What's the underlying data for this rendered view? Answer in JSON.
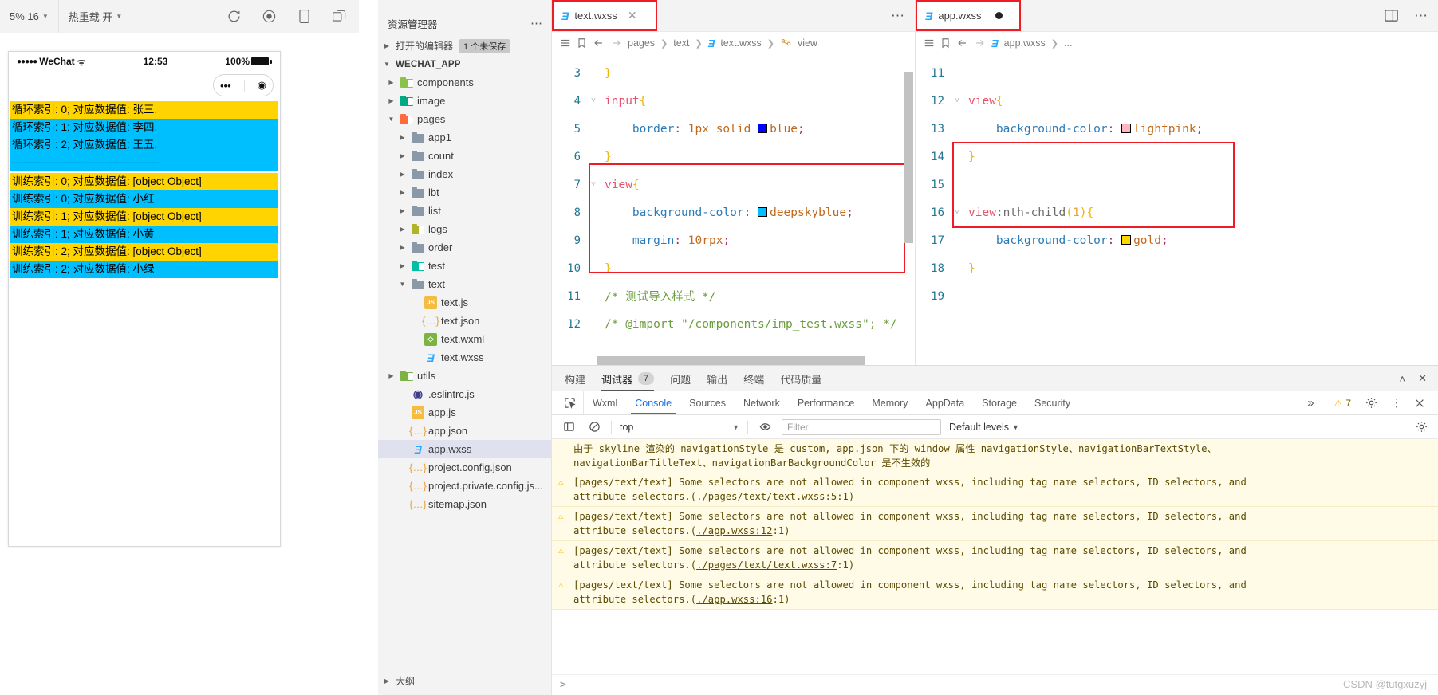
{
  "simulator": {
    "toolbar": {
      "zoom_label": "5% 16",
      "hotreload_label": "热重载 开",
      "icons": [
        "refresh-icon",
        "record-icon",
        "device-icon",
        "rotate-icon"
      ]
    },
    "phone": {
      "carrier": "WeChat",
      "time": "12:53",
      "battery": "100%",
      "capsule": {
        "more": "•••",
        "target": "◉"
      }
    },
    "rows": [
      {
        "text": "循环索引: 0; 对应数据值: 张三.",
        "bg": "gold"
      },
      {
        "text": "循环索引: 1; 对应数据值: 李四.",
        "bg": "sky"
      },
      {
        "text": "循环索引: 2; 对应数据值: 王五.",
        "bg": "sky"
      },
      {
        "text": "-----------------------------------------",
        "bg": "sky"
      },
      {
        "text": "训练索引: 0; 对应数据值: [object Object]",
        "bg": "gold"
      },
      {
        "text": "训练索引: 0; 对应数据值: 小红",
        "bg": "sky"
      },
      {
        "text": "训练索引: 1; 对应数据值: [object Object]",
        "bg": "gold"
      },
      {
        "text": "训练索引: 1; 对应数据值: 小黄",
        "bg": "sky"
      },
      {
        "text": "训练索引: 2; 对应数据值: [object Object]",
        "bg": "gold"
      },
      {
        "text": "训练索引: 2; 对应数据值: 小绿",
        "bg": "sky"
      }
    ]
  },
  "explorer": {
    "title": "资源管理器",
    "open_editors": {
      "label": "打开的编辑器",
      "badge": "1 个未保存"
    },
    "project": "WECHAT_APP",
    "tree": [
      {
        "label": "components",
        "type": "folder",
        "color": "#8bc34a",
        "indent": 1,
        "arrow": "▸"
      },
      {
        "label": "image",
        "type": "folder",
        "color": "#00a884",
        "indent": 1,
        "arrow": "▸"
      },
      {
        "label": "pages",
        "type": "folder",
        "color": "#ff6a3d",
        "indent": 1,
        "arrow": "▾"
      },
      {
        "label": "app1",
        "type": "folder",
        "color": "#8a99a8",
        "indent": 2,
        "arrow": "▸"
      },
      {
        "label": "count",
        "type": "folder",
        "color": "#8a99a8",
        "indent": 2,
        "arrow": "▸"
      },
      {
        "label": "index",
        "type": "folder",
        "color": "#8a99a8",
        "indent": 2,
        "arrow": "▸"
      },
      {
        "label": "lbt",
        "type": "folder",
        "color": "#8a99a8",
        "indent": 2,
        "arrow": "▸"
      },
      {
        "label": "list",
        "type": "folder",
        "color": "#8a99a8",
        "indent": 2,
        "arrow": "▸"
      },
      {
        "label": "logs",
        "type": "folder",
        "color": "#afb42b",
        "indent": 2,
        "arrow": "▸"
      },
      {
        "label": "order",
        "type": "folder",
        "color": "#8a99a8",
        "indent": 2,
        "arrow": "▸"
      },
      {
        "label": "test",
        "type": "folder",
        "color": "#00bfa5",
        "indent": 2,
        "arrow": "▸"
      },
      {
        "label": "text",
        "type": "folder",
        "color": "#8a99a8",
        "indent": 2,
        "arrow": "▾"
      },
      {
        "label": "text.js",
        "type": "js",
        "indent": 3,
        "arrow": ""
      },
      {
        "label": "text.json",
        "type": "json",
        "indent": 3,
        "arrow": ""
      },
      {
        "label": "text.wxml",
        "type": "wxml",
        "indent": 3,
        "arrow": ""
      },
      {
        "label": "text.wxss",
        "type": "wxss",
        "indent": 3,
        "arrow": ""
      },
      {
        "label": "utils",
        "type": "folder",
        "color": "#7cb342",
        "indent": 1,
        "arrow": "▸"
      },
      {
        "label": ".eslintrc.js",
        "type": "eslint",
        "indent": 2,
        "arrow": ""
      },
      {
        "label": "app.js",
        "type": "js",
        "indent": 2,
        "arrow": ""
      },
      {
        "label": "app.json",
        "type": "json",
        "indent": 2,
        "arrow": ""
      },
      {
        "label": "app.wxss",
        "type": "wxss",
        "indent": 2,
        "arrow": "",
        "selected": true
      },
      {
        "label": "project.config.json",
        "type": "json",
        "indent": 2,
        "arrow": ""
      },
      {
        "label": "project.private.config.js...",
        "type": "json",
        "indent": 2,
        "arrow": ""
      },
      {
        "label": "sitemap.json",
        "type": "json",
        "indent": 2,
        "arrow": ""
      }
    ],
    "bottom_section": "大纲"
  },
  "editor_left": {
    "tab": {
      "label": "text.wxss",
      "icon": "wxss-icon",
      "close": "✕"
    },
    "breadcrumb": [
      "pages",
      "text",
      "text.wxss",
      "view"
    ],
    "lines": [
      {
        "n": "3",
        "fold": "",
        "segs": [
          {
            "t": "}",
            "c": "k-brace"
          }
        ]
      },
      {
        "n": "4",
        "fold": "˅",
        "segs": [
          {
            "t": "input",
            "c": "k-sel"
          },
          {
            "t": "{",
            "c": "k-brace"
          }
        ]
      },
      {
        "n": "5",
        "fold": "",
        "segs": [
          {
            "t": "    border",
            "c": "k-prop"
          },
          {
            "t": ":",
            "c": "k-colon"
          },
          {
            "t": " 1px solid ",
            "c": "k-val"
          },
          {
            "t": "@swatch:#0000ff",
            "c": "sw"
          },
          {
            "t": "blue",
            "c": "k-val"
          },
          {
            "t": ";",
            "c": "k-semi"
          }
        ]
      },
      {
        "n": "6",
        "fold": "",
        "segs": [
          {
            "t": "}",
            "c": "k-brace"
          }
        ]
      },
      {
        "n": "7",
        "fold": "˅",
        "segs": [
          {
            "t": "view",
            "c": "k-sel"
          },
          {
            "t": "{",
            "c": "k-brace"
          }
        ]
      },
      {
        "n": "8",
        "fold": "",
        "segs": [
          {
            "t": "    background-color",
            "c": "k-prop"
          },
          {
            "t": ":",
            "c": "k-colon"
          },
          {
            "t": " ",
            "c": "k-val"
          },
          {
            "t": "@swatch:#00bfff",
            "c": "sw"
          },
          {
            "t": "deepskyblue",
            "c": "k-val"
          },
          {
            "t": ";",
            "c": "k-semi"
          }
        ]
      },
      {
        "n": "9",
        "fold": "",
        "segs": [
          {
            "t": "    margin",
            "c": "k-prop"
          },
          {
            "t": ":",
            "c": "k-colon"
          },
          {
            "t": " 10rpx",
            "c": "k-num"
          },
          {
            "t": ";",
            "c": "k-semi"
          }
        ]
      },
      {
        "n": "10",
        "fold": "",
        "segs": [
          {
            "t": "}",
            "c": "k-brace"
          }
        ]
      },
      {
        "n": "11",
        "fold": "",
        "segs": [
          {
            "t": "/* 测试导入样式 */",
            "c": "k-cmt"
          }
        ]
      },
      {
        "n": "12",
        "fold": "",
        "segs": [
          {
            "t": "/* @import \"/components/imp_test.wxss\"; */",
            "c": "k-cmt"
          }
        ]
      }
    ]
  },
  "editor_right": {
    "tab": {
      "label": "app.wxss",
      "icon": "wxss-icon",
      "dirty": true
    },
    "breadcrumb": [
      "app.wxss",
      "..."
    ],
    "lines": [
      {
        "n": "11",
        "fold": "",
        "segs": []
      },
      {
        "n": "12",
        "fold": "˅",
        "segs": [
          {
            "t": "view",
            "c": "k-sel"
          },
          {
            "t": "{",
            "c": "k-brace"
          }
        ]
      },
      {
        "n": "13",
        "fold": "",
        "segs": [
          {
            "t": "    background-color",
            "c": "k-prop"
          },
          {
            "t": ":",
            "c": "k-colon"
          },
          {
            "t": " ",
            "c": "k-val"
          },
          {
            "t": "@swatch:#ffb6c1",
            "c": "sw"
          },
          {
            "t": "lightpink",
            "c": "k-val"
          },
          {
            "t": ";",
            "c": "k-semi"
          }
        ]
      },
      {
        "n": "14",
        "fold": "",
        "segs": [
          {
            "t": "}",
            "c": "k-brace"
          }
        ]
      },
      {
        "n": "15",
        "fold": "",
        "segs": []
      },
      {
        "n": "16",
        "fold": "˅",
        "segs": [
          {
            "t": "view",
            "c": "k-sel"
          },
          {
            "t": ":nth-child",
            "c": "k-pseudo"
          },
          {
            "t": "(",
            "c": "k-brace"
          },
          {
            "t": "1",
            "c": "k-pnum"
          },
          {
            "t": ")",
            "c": "k-brace"
          },
          {
            "t": "{",
            "c": "k-brace"
          }
        ]
      },
      {
        "n": "17",
        "fold": "",
        "segs": [
          {
            "t": "    background-color",
            "c": "k-prop"
          },
          {
            "t": ":",
            "c": "k-colon"
          },
          {
            "t": " ",
            "c": "k-val"
          },
          {
            "t": "@swatch:#ffd700",
            "c": "sw"
          },
          {
            "t": "gold",
            "c": "k-val"
          },
          {
            "t": ";",
            "c": "k-semi"
          }
        ]
      },
      {
        "n": "18",
        "fold": "",
        "segs": [
          {
            "t": "}",
            "c": "k-brace"
          }
        ]
      },
      {
        "n": "19",
        "fold": "",
        "segs": []
      }
    ]
  },
  "panel": {
    "tabs": [
      {
        "label": "构建",
        "active": false
      },
      {
        "label": "调试器",
        "active": true,
        "count": "7"
      },
      {
        "label": "问题",
        "active": false
      },
      {
        "label": "输出",
        "active": false
      },
      {
        "label": "终端",
        "active": false
      },
      {
        "label": "代码质量",
        "active": false
      }
    ],
    "devtools_tabs": [
      {
        "label": "Wxml",
        "active": false
      },
      {
        "label": "Console",
        "active": true
      },
      {
        "label": "Sources",
        "active": false
      },
      {
        "label": "Network",
        "active": false
      },
      {
        "label": "Performance",
        "active": false
      },
      {
        "label": "Memory",
        "active": false
      },
      {
        "label": "AppData",
        "active": false
      },
      {
        "label": "Storage",
        "active": false
      },
      {
        "label": "Security",
        "active": false
      }
    ],
    "devtools_more": "»",
    "warning_count": "7",
    "console_toolbar": {
      "context": "top",
      "filter_placeholder": "Filter",
      "levels": "Default levels"
    },
    "logs": [
      {
        "type": "plain",
        "text": "由于 skyline 渲染的 navigationStyle 是 custom, app.json 下的 window 属性 navigationStyle、navigationBarTextStyle、\nnavigationBarTitleText、navigationBarBackgroundColor 是不生效的"
      },
      {
        "type": "warning",
        "text": "[pages/text/text] Some selectors are not allowed in component wxss, including tag name selectors, ID selectors, and\nattribute selectors.(./pages/text/text.wxss:5:1)",
        "link": "./pages/text/text.wxss:5"
      },
      {
        "type": "warning",
        "text": "[pages/text/text] Some selectors are not allowed in component wxss, including tag name selectors, ID selectors, and\nattribute selectors.(./app.wxss:12:1)",
        "link": "./app.wxss:12"
      },
      {
        "type": "warning",
        "text": "[pages/text/text] Some selectors are not allowed in component wxss, including tag name selectors, ID selectors, and\nattribute selectors.(./pages/text/text.wxss:7:1)",
        "link": "./pages/text/text.wxss:7"
      },
      {
        "type": "warning",
        "text": "[pages/text/text] Some selectors are not allowed in component wxss, including tag name selectors, ID selectors, and\nattribute selectors.(./app.wxss:16:1)",
        "link": "./app.wxss:16"
      }
    ],
    "prompt": ">"
  },
  "watermark": "CSDN @tutgxuzyj",
  "colors": {
    "accent_red": "#ee1c25",
    "gold": "#ffd400",
    "sky": "#00bfff",
    "warn_bg": "#fffbe6",
    "link_blue": "#1a73e8"
  }
}
